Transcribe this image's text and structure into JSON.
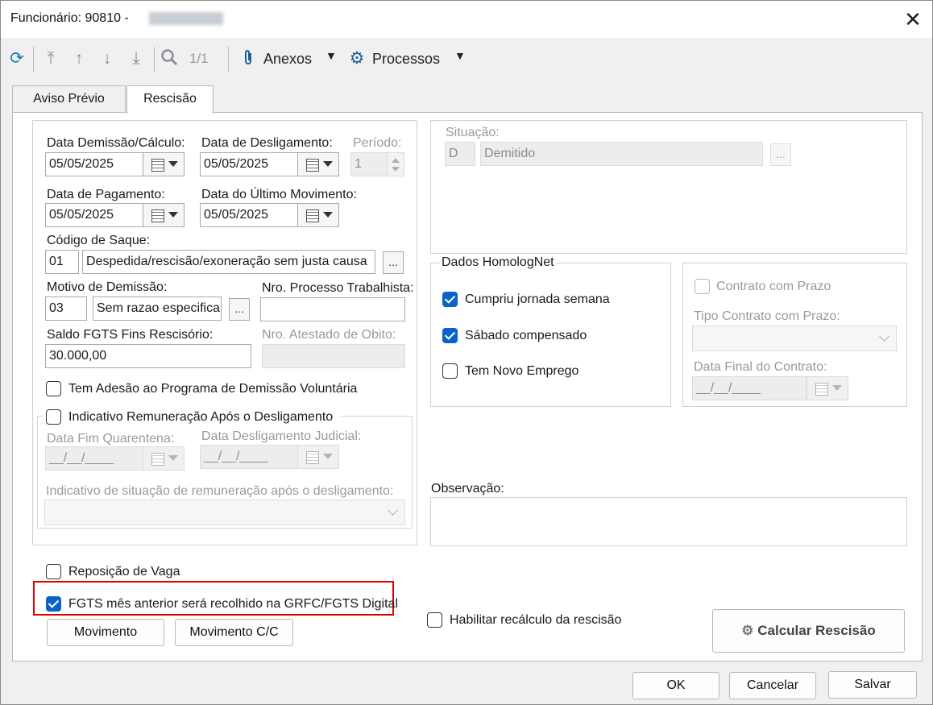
{
  "window": {
    "title": "Funcionário: 90810 -",
    "close_glyph": "✕"
  },
  "toolbar": {
    "count": "1/1",
    "anexos": "Anexos",
    "processos": "Processos",
    "icons": [
      "refresh-icon",
      "first-record-icon",
      "previous-record-icon",
      "next-record-icon",
      "last-record-icon",
      "search-icon",
      "paperclip-icon",
      "gear-icon"
    ]
  },
  "tabs": [
    {
      "label": "Aviso Prévio",
      "active": false
    },
    {
      "label": "Rescisão",
      "active": true
    }
  ],
  "form": {
    "data_demissao": {
      "label": "Data Demissão/Cálculo:",
      "value": "05/05/2025"
    },
    "data_desligamento": {
      "label": "Data de Desligamento:",
      "value": "05/05/2025"
    },
    "periodo": {
      "label": "Período:",
      "value": "1"
    },
    "data_pagamento": {
      "label": "Data de Pagamento:",
      "value": "05/05/2025"
    },
    "data_ultimo_mov": {
      "label": "Data do Último Movimento:",
      "value": "05/05/2025"
    },
    "codigo_saque": {
      "label": "Código de Saque:",
      "code": "01",
      "desc": "Despedida/rescisão/exoneração sem justa causa"
    },
    "motivo_demissao": {
      "label": "Motivo de Demissão:",
      "code": "03",
      "desc": "Sem razao especifica"
    },
    "nro_processo": {
      "label": "Nro. Processo Trabalhista:",
      "value": ""
    },
    "saldo_fgts": {
      "label": "Saldo FGTS Fins Rescisório:",
      "value": "30.000,00"
    },
    "nro_atestado": {
      "label": "Nro. Atestado de Obito:",
      "value": ""
    },
    "tem_adesao": {
      "label": "Tem Adesão ao Programa de Demissão Voluntária",
      "checked": false
    },
    "indicativo_rem": {
      "label": "Indicativo Remuneração Após o Desligamento",
      "checked": false
    },
    "data_fim_quarentena": {
      "label": "Data Fim Quarentena:",
      "value": "__/__/____"
    },
    "data_desl_judicial": {
      "label": "Data Desligamento Judicial:",
      "value": "__/__/____"
    },
    "indicativo_situacao": {
      "label": "Indicativo de situação de remuneração após o desligamento:",
      "value": ""
    },
    "reposicao_vaga": {
      "label": "Reposição de Vaga",
      "checked": false
    },
    "fgts_mes_anterior": {
      "label": "FGTS mês anterior será recolhido na GRFC/FGTS Digital",
      "checked": true
    },
    "habilitar_recalculo": {
      "label": "Habilitar recálculo da rescisão",
      "checked": false
    }
  },
  "situacao": {
    "label": "Situação:",
    "code": "D",
    "desc": "Demitido"
  },
  "homolognet": {
    "title": "Dados HomologNet",
    "cumpriu_jornada": {
      "label": "Cumpriu jornada semana",
      "checked": true
    },
    "sabado_compensado": {
      "label": "Sábado compensado",
      "checked": true
    },
    "novo_emprego": {
      "label": "Tem Novo Emprego",
      "checked": false
    }
  },
  "contrato": {
    "contrato_prazo": {
      "label": "Contrato com Prazo",
      "checked": false
    },
    "tipo_contrato": {
      "label": "Tipo Contrato com Prazo:",
      "value": ""
    },
    "data_final": {
      "label": "Data Final do Contrato:",
      "value": "__/__/____"
    }
  },
  "observacao": {
    "label": "Observação:",
    "value": ""
  },
  "buttons": {
    "dots": "...",
    "movimento": "Movimento",
    "movimento_cc": "Movimento C/C",
    "calcular": "Calcular Rescisão",
    "ok": "OK",
    "cancelar": "Cancelar",
    "salvar": "Salvar"
  },
  "colors": {
    "accent": "#0a63c9",
    "highlight": "#e00000"
  }
}
